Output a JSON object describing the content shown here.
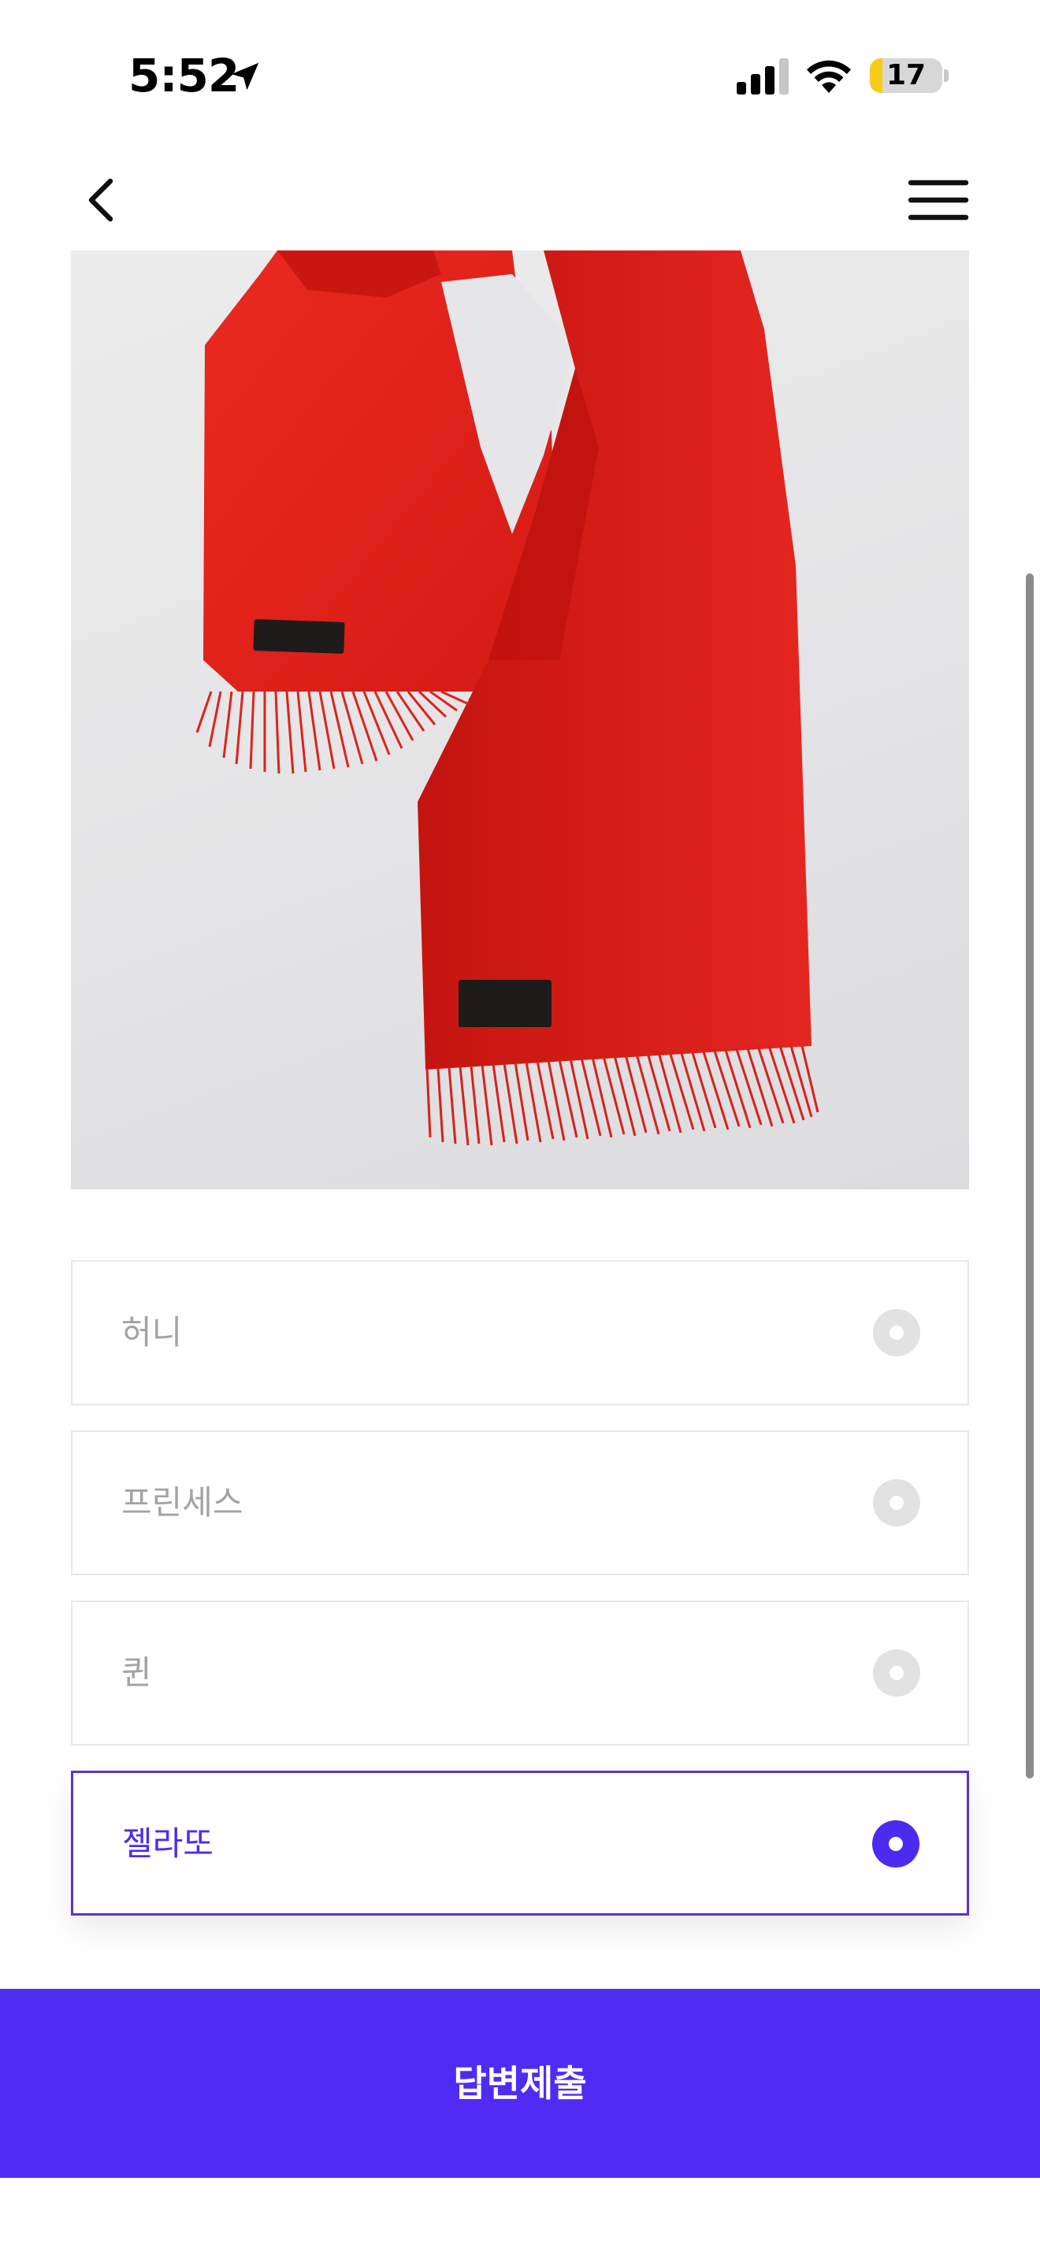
{
  "status_bar": {
    "time": "5:52",
    "battery_level": "17",
    "battery_fraction": 0.17,
    "icons": [
      "location-arrow-icon",
      "signal-icon",
      "wifi-icon",
      "battery-icon"
    ]
  },
  "nav": {
    "back_icon": "chevron-left-icon",
    "menu_icon": "hamburger-menu-icon"
  },
  "product": {
    "image_alt": "red scarf"
  },
  "options": [
    {
      "label": "허니",
      "selected": false
    },
    {
      "label": "프린세스",
      "selected": false
    },
    {
      "label": "퀸",
      "selected": false
    },
    {
      "label": "젤라또",
      "selected": true
    }
  ],
  "submit": {
    "label": "답변제출"
  },
  "colors": {
    "accent": "#4e2cf4",
    "selected_text": "#4c2bf0",
    "selected_border": "#5a35c9",
    "unselected_text": "#a3a3a3",
    "radio_inactive": "#e2e2e2",
    "scarf": "#e32119"
  }
}
